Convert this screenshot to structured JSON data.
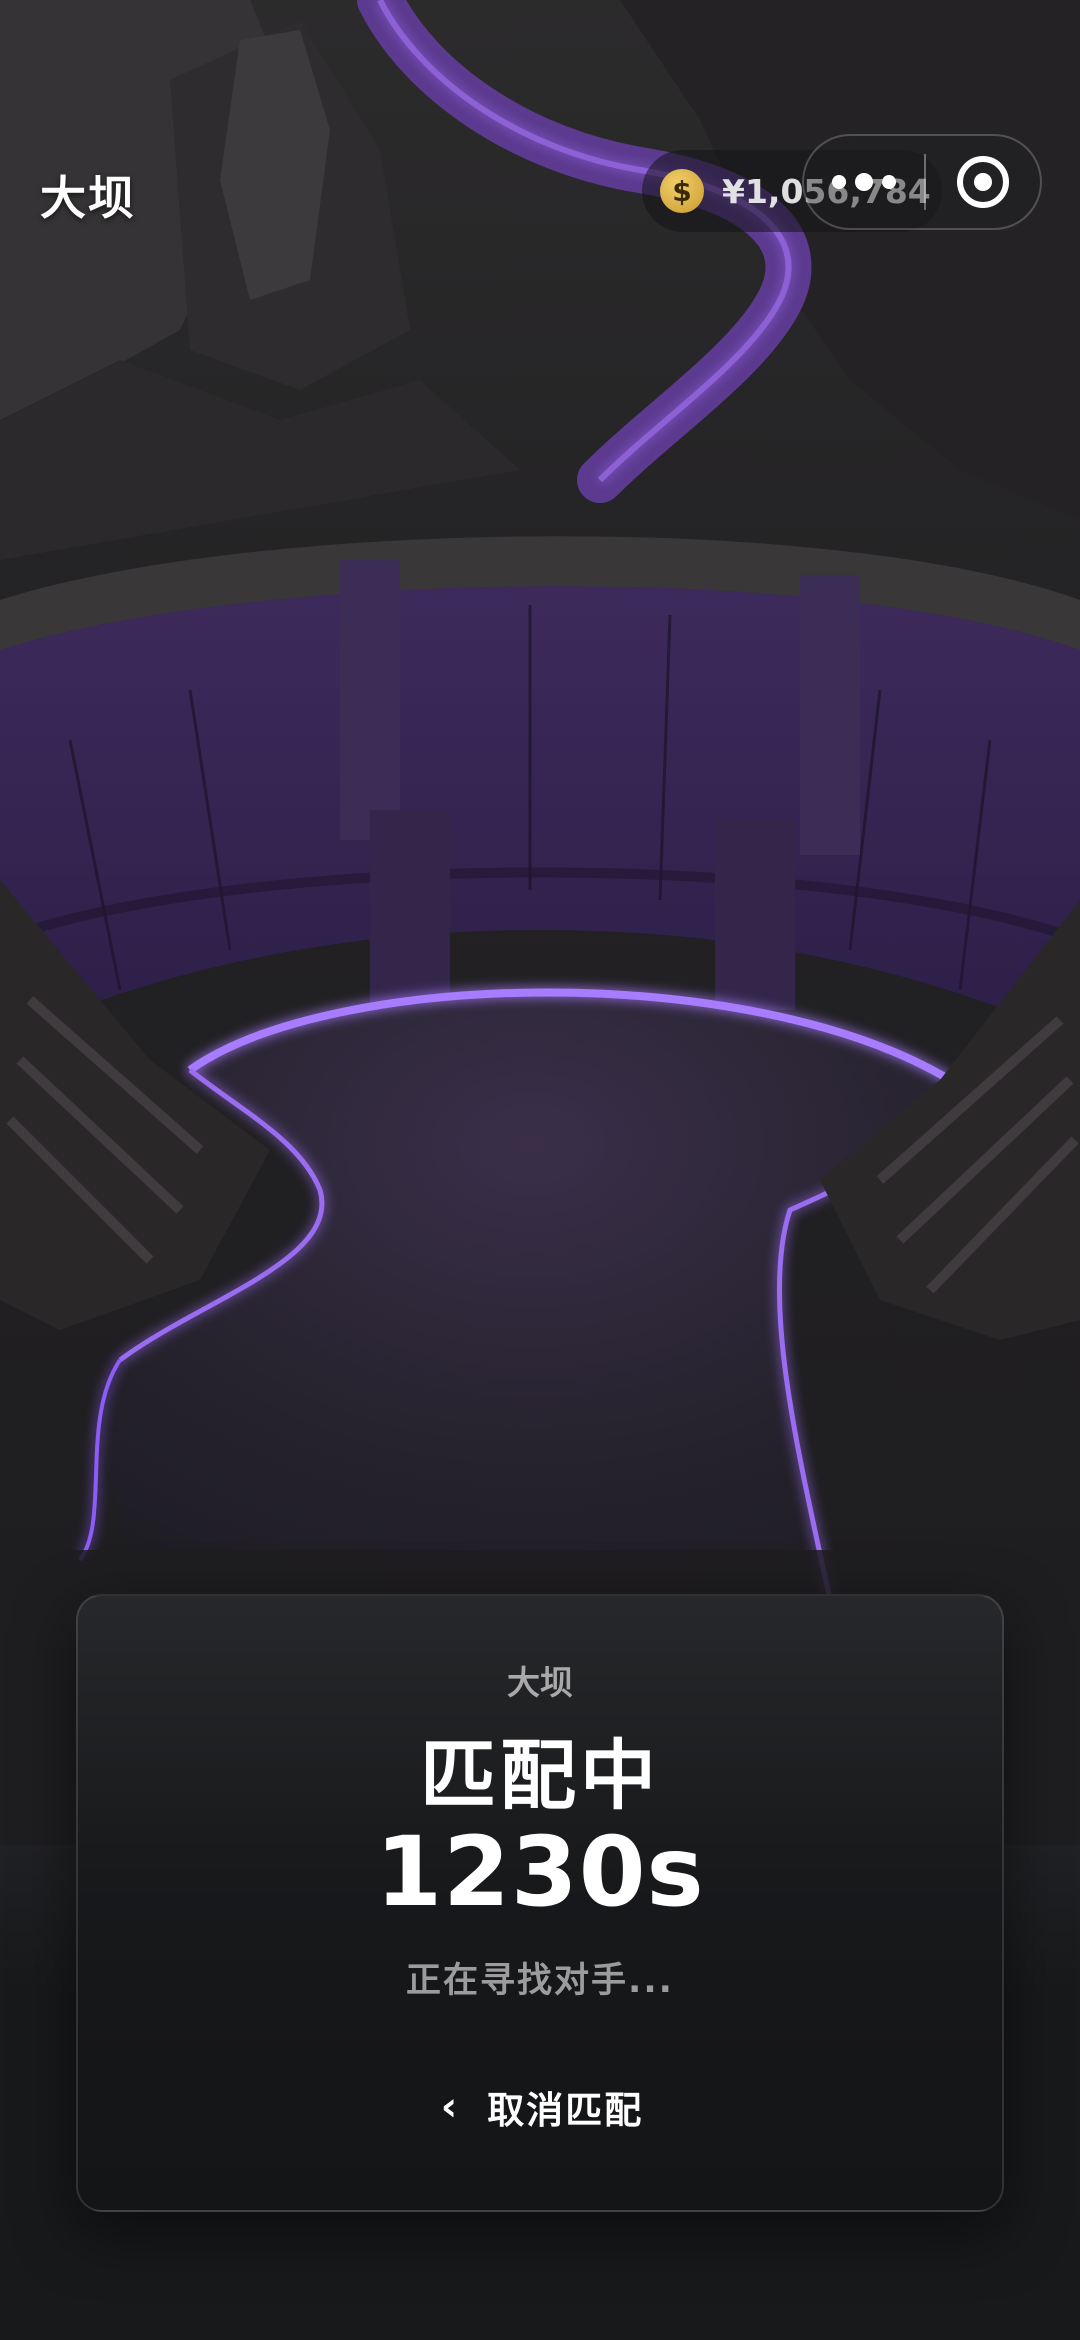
{
  "header": {
    "title": "大坝",
    "balance": {
      "icon": "dollar-coin-icon",
      "symbol": "$",
      "amount": "¥1,056,784"
    },
    "capsule": {
      "more_icon": "more-dots-icon",
      "close_icon": "target-close-icon"
    }
  },
  "match_card": {
    "map_name": "大坝",
    "status": "匹配中",
    "timer": "1230s",
    "hint": "正在寻找对手...",
    "cancel": {
      "icon": "chevron-left-icon",
      "label": "取消匹配"
    }
  },
  "colors": {
    "background": "#18191b",
    "glow_purple": "#8b5cf6",
    "dam_purple": "#4a2f6e",
    "coin_gold": "#d4a63a"
  }
}
